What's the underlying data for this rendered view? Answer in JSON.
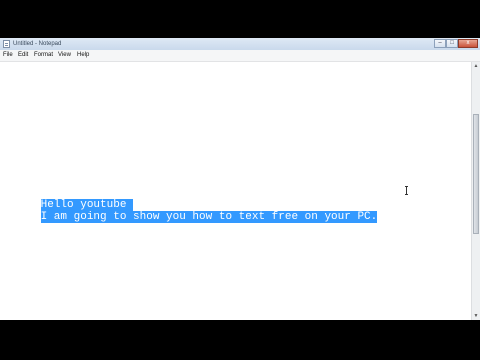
{
  "window": {
    "title": "Untitled - Notepad",
    "controls": {
      "minimize": "–",
      "maximize": "□",
      "close": "x"
    }
  },
  "menu": {
    "items": [
      "File",
      "Edit",
      "Format",
      "View",
      "Help"
    ]
  },
  "editor": {
    "lines": [
      "Hello youtube ",
      "I am going to show you how to text free on your PC."
    ],
    "selection": "all",
    "selection_color": "#3399ff"
  },
  "scrollbar": {
    "up": "▲",
    "down": "▼"
  }
}
